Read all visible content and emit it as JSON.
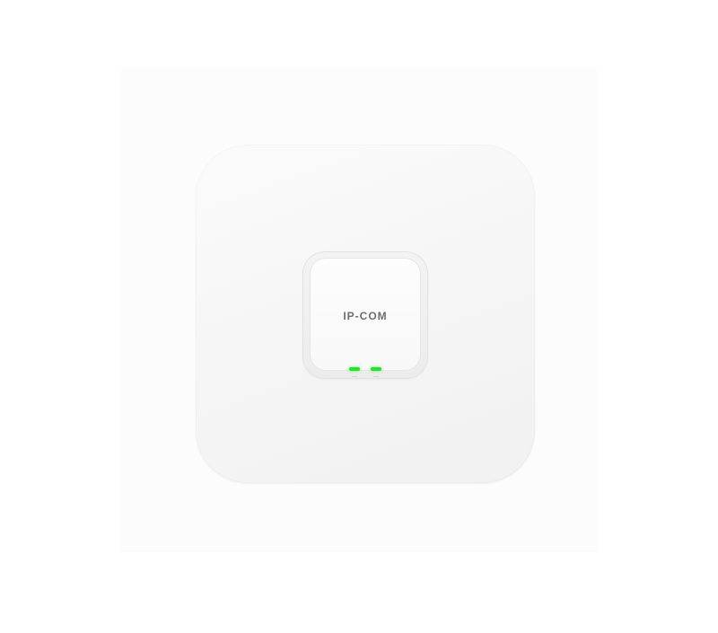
{
  "product": {
    "brand_text": "IP-COM",
    "led_color": "#27e22a",
    "body_color": "#f6f6f6",
    "led_count": 2
  }
}
